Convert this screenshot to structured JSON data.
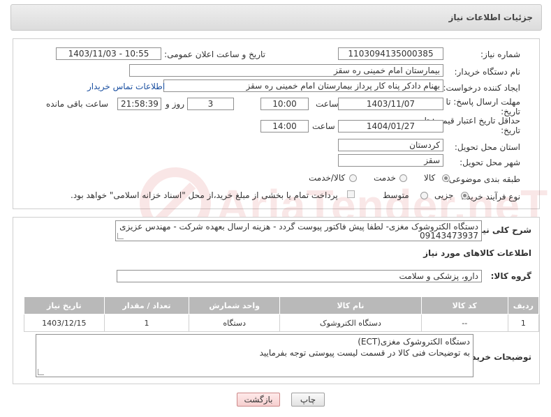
{
  "header": {
    "title": "جزئیات اطلاعات نیاز"
  },
  "form": {
    "need_number_label": "شماره نیاز:",
    "need_number": "1103094135000385",
    "announce_label": "تاریخ و ساعت اعلان عمومی:",
    "announce_value": "1403/11/03 - 10:55",
    "buyer_org_label": "نام دستگاه خریدار:",
    "buyer_org": "بیمارستان امام خمینی  ره  سقز",
    "creator_label": "ایجاد کننده درخواست:",
    "creator": "بهنام دادکر پناه کار پرداز بیمارستان امام خمینی  ره  سقز",
    "contact_link": "اطلاعات تماس خریدار",
    "deadline_label_1": "مهلت ارسال پاسخ: تا",
    "deadline_label_2": "تاریخ:",
    "deadline_date": "1403/11/07",
    "time_label": "ساعت",
    "deadline_time": "10:00",
    "days_value": "3",
    "days_label": "روز و",
    "remaining_time": "21:58:39",
    "remaining_label": "ساعت باقی مانده",
    "validity_label_1": "حداقل تاریخ اعتبار قیمت: تا",
    "validity_label_2": "تاریخ:",
    "validity_date": "1404/01/27",
    "validity_time_label": "ساعت",
    "validity_time": "14:00",
    "province_label": "استان محل تحویل:",
    "province": "کردستان",
    "city_label": "شهر محل تحویل:",
    "city": "سقز",
    "category_label": "طبقه بندی موضوعی:",
    "category_options": [
      "کالا",
      "خدمت",
      "کالا/خدمت"
    ],
    "category_selected": 0,
    "process_label": "نوع فرآیند خرید :",
    "process_options": [
      "جزیی",
      "متوسط"
    ],
    "process_selected": 0,
    "payment_note": "پرداخت تمام یا بخشی از مبلغ خرید،از محل \"اسناد خزانه اسلامی\" خواهد بود."
  },
  "general": {
    "summary_label": "شرح کلی نیاز:",
    "summary": "دستگاه الکتروشوک مغزی- لطفا پیش فاکتور پیوست گردد - هزینه ارسال بعهده شرکت - مهندس عزیزی 09143473937",
    "goods_info_title": "اطلاعات کالاهای مورد نیاز",
    "goods_group_label": "گروه کالا:",
    "goods_group": "دارو، پزشکی و سلامت"
  },
  "table": {
    "columns": [
      "ردیف",
      "کد کالا",
      "نام کالا",
      "واحد شمارش",
      "تعداد / مقدار",
      "تاریخ نیاز"
    ],
    "rows": [
      [
        "1",
        "--",
        "دستگاه الکتروشوک",
        "دستگاه",
        "1",
        "1403/12/15"
      ]
    ]
  },
  "buyer_notes": {
    "label": "توضیحات خریدار:",
    "line1": "دستگاه الکتروشوک مغزی(ECT)",
    "line2": "به  توضیحات فنی کالا در قسمت لیست پیوستی توجه بفرمایید"
  },
  "buttons": {
    "print": "چاپ",
    "back": "بازگشت"
  },
  "watermark": {
    "text": "AriaTender.neT"
  },
  "colors": {
    "header_bg": "#e4e4e4",
    "table_header": "#b9b9b9",
    "link": "#1a4fa0",
    "watermark": "#cd3c3c"
  }
}
